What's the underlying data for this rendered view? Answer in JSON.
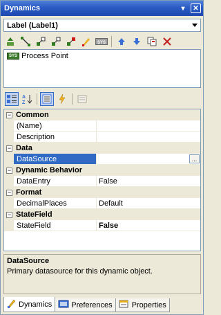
{
  "window": {
    "title": "Dynamics",
    "pin_glyph": "▾",
    "close_glyph": "✕"
  },
  "combo": {
    "value": "Label (Label1)"
  },
  "toolbar1": {
    "icons": [
      "up-arrow-green-icon",
      "connect-icon",
      "link-square-icon",
      "link-plus-icon",
      "link-red-icon",
      "color-pen-icon",
      "sys-tag-icon",
      "move-up-icon",
      "move-down-icon",
      "copy-icon",
      "delete-icon"
    ]
  },
  "list": {
    "items": [
      {
        "icon": "SYS",
        "label": "Process Point"
      }
    ]
  },
  "grid": {
    "categories": [
      {
        "label": "Common",
        "rows": [
          {
            "name": "(Name)",
            "value": ""
          },
          {
            "name": "Description",
            "value": ""
          }
        ]
      },
      {
        "label": "Data",
        "rows": [
          {
            "name": "DataSource",
            "value": "",
            "selected": true,
            "ellipsis": "..."
          }
        ]
      },
      {
        "label": "Dynamic Behavior",
        "rows": [
          {
            "name": "DataEntry",
            "value": "False"
          }
        ]
      },
      {
        "label": "Format",
        "rows": [
          {
            "name": "DecimalPlaces",
            "value": "Default"
          }
        ]
      },
      {
        "label": "StateField",
        "rows": [
          {
            "name": "StateField",
            "value": "False",
            "bold": true
          }
        ]
      }
    ]
  },
  "description": {
    "title": "DataSource",
    "text": "Primary datasource for this dynamic object."
  },
  "tabs": [
    {
      "label": "Dynamics",
      "icon": "dynamics-tab-icon",
      "active": true
    },
    {
      "label": "Preferences",
      "icon": "preferences-tab-icon",
      "active": false
    },
    {
      "label": "Properties",
      "icon": "properties-tab-icon",
      "active": false
    }
  ]
}
